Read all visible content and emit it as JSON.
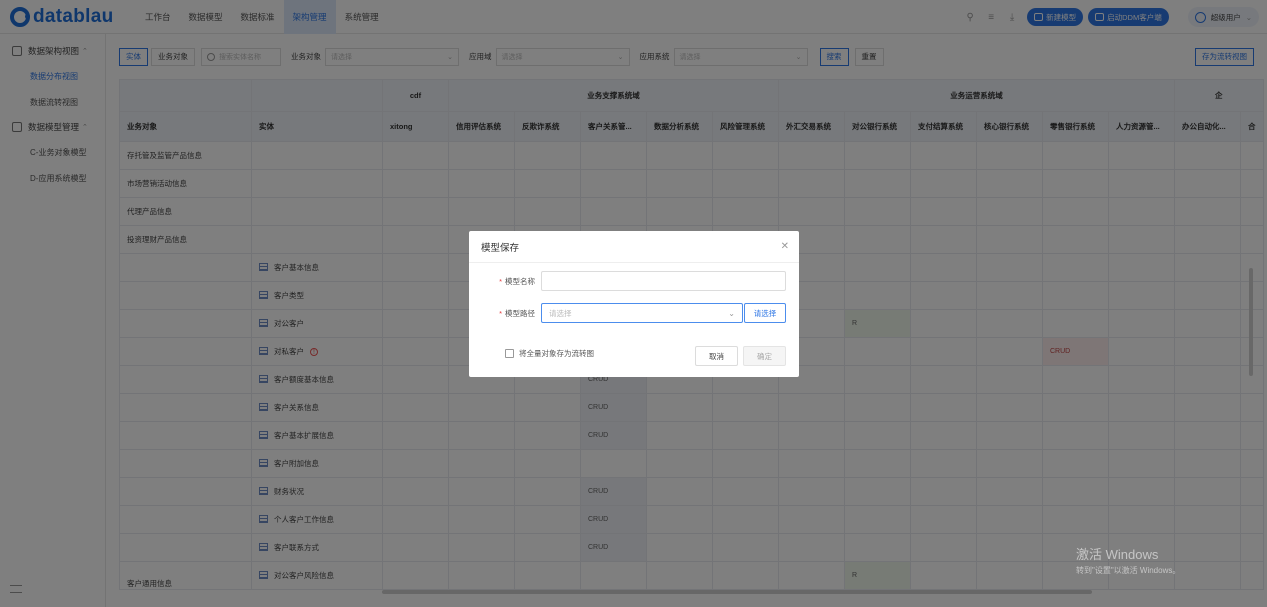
{
  "app": {
    "logo_text": "datablau",
    "nav": [
      "工作台",
      "数据模型",
      "数据标准",
      "架构管理",
      "系统管理"
    ],
    "nav_active_index": 3,
    "new_model": "新建模型",
    "launch_ddm": "启动DDM客户端",
    "user_name": "超级用户",
    "accent": "#2f77e5"
  },
  "sidebar": {
    "group1": "数据架构视图",
    "group1_items": [
      "数据分布视图",
      "数据流转视图"
    ],
    "group2": "数据模型管理",
    "group2_items": [
      "C-业务对象模型",
      "D-应用系统模型"
    ]
  },
  "filters": {
    "tab_entity": "实体",
    "tab_bizobj": "业务对象",
    "search_placeholder": "搜索实体名称",
    "bizobj_label": "业务对象",
    "bizobj_placeholder": "请选择",
    "appdomain_label": "应用域",
    "appdomain_placeholder": "请选择",
    "appsys_label": "应用系统",
    "appsys_placeholder": "请选择",
    "search_btn": "搜索",
    "reset_btn": "重置",
    "save_flow_btn": "存为流转视图"
  },
  "grid": {
    "groups": [
      "cdf",
      "业务支撑系统域",
      "业务运营系统域",
      "企"
    ],
    "col_bizobj": "业务对象",
    "col_entity": "实体",
    "systems": [
      "xitong",
      "信用评估系统",
      "反欺诈系统",
      "客户关系管...",
      "数据分析系统",
      "风险管理系统",
      "外汇交易系统",
      "对公银行系统",
      "支付结算系统",
      "核心银行系统",
      "零售银行系统",
      "人力资源管...",
      "办公自动化...",
      "合"
    ],
    "bizobj_rows": [
      "存托管及监管产品信息",
      "市场营销活动信息",
      "代理产品信息",
      "投资理财产品信息"
    ],
    "entity_rows": [
      {
        "name": "客户基本信息",
        "cells": {}
      },
      {
        "name": "客户类型",
        "cells": {}
      },
      {
        "name": "对公客户",
        "cells": {
          "7": "R"
        }
      },
      {
        "name": "对私客户",
        "warn": "!",
        "cells": {
          "10": "CRUD"
        }
      },
      {
        "name": "客户额度基本信息",
        "cells": {
          "3": "CRUD"
        }
      },
      {
        "name": "客户关系信息",
        "cells": {
          "3": "CRUD"
        }
      },
      {
        "name": "客户基本扩展信息",
        "cells": {
          "3": "CRUD"
        }
      },
      {
        "name": "客户附加信息",
        "cells": {}
      },
      {
        "name": "财务状况",
        "cells": {
          "3": "CRUD"
        }
      },
      {
        "name": "个人客户工作信息",
        "cells": {
          "3": "CRUD"
        }
      },
      {
        "name": "客户联系方式",
        "cells": {
          "3": "CRUD"
        }
      },
      {
        "name": "对公客户风险信息",
        "cells": {
          "7": "R"
        }
      }
    ],
    "group_bizobj_label": "客户通用信息"
  },
  "dialog": {
    "title": "模型保存",
    "name_label": "模型名称",
    "path_label": "模型路径",
    "path_placeholder": "请选择",
    "path_select_btn": "请选择",
    "checkbox_label": "将全量对象存为流转图",
    "cancel": "取消",
    "ok": "确定"
  },
  "watermark": {
    "line1": "激活 Windows",
    "line2": "转到\"设置\"以激活 Windows。"
  }
}
